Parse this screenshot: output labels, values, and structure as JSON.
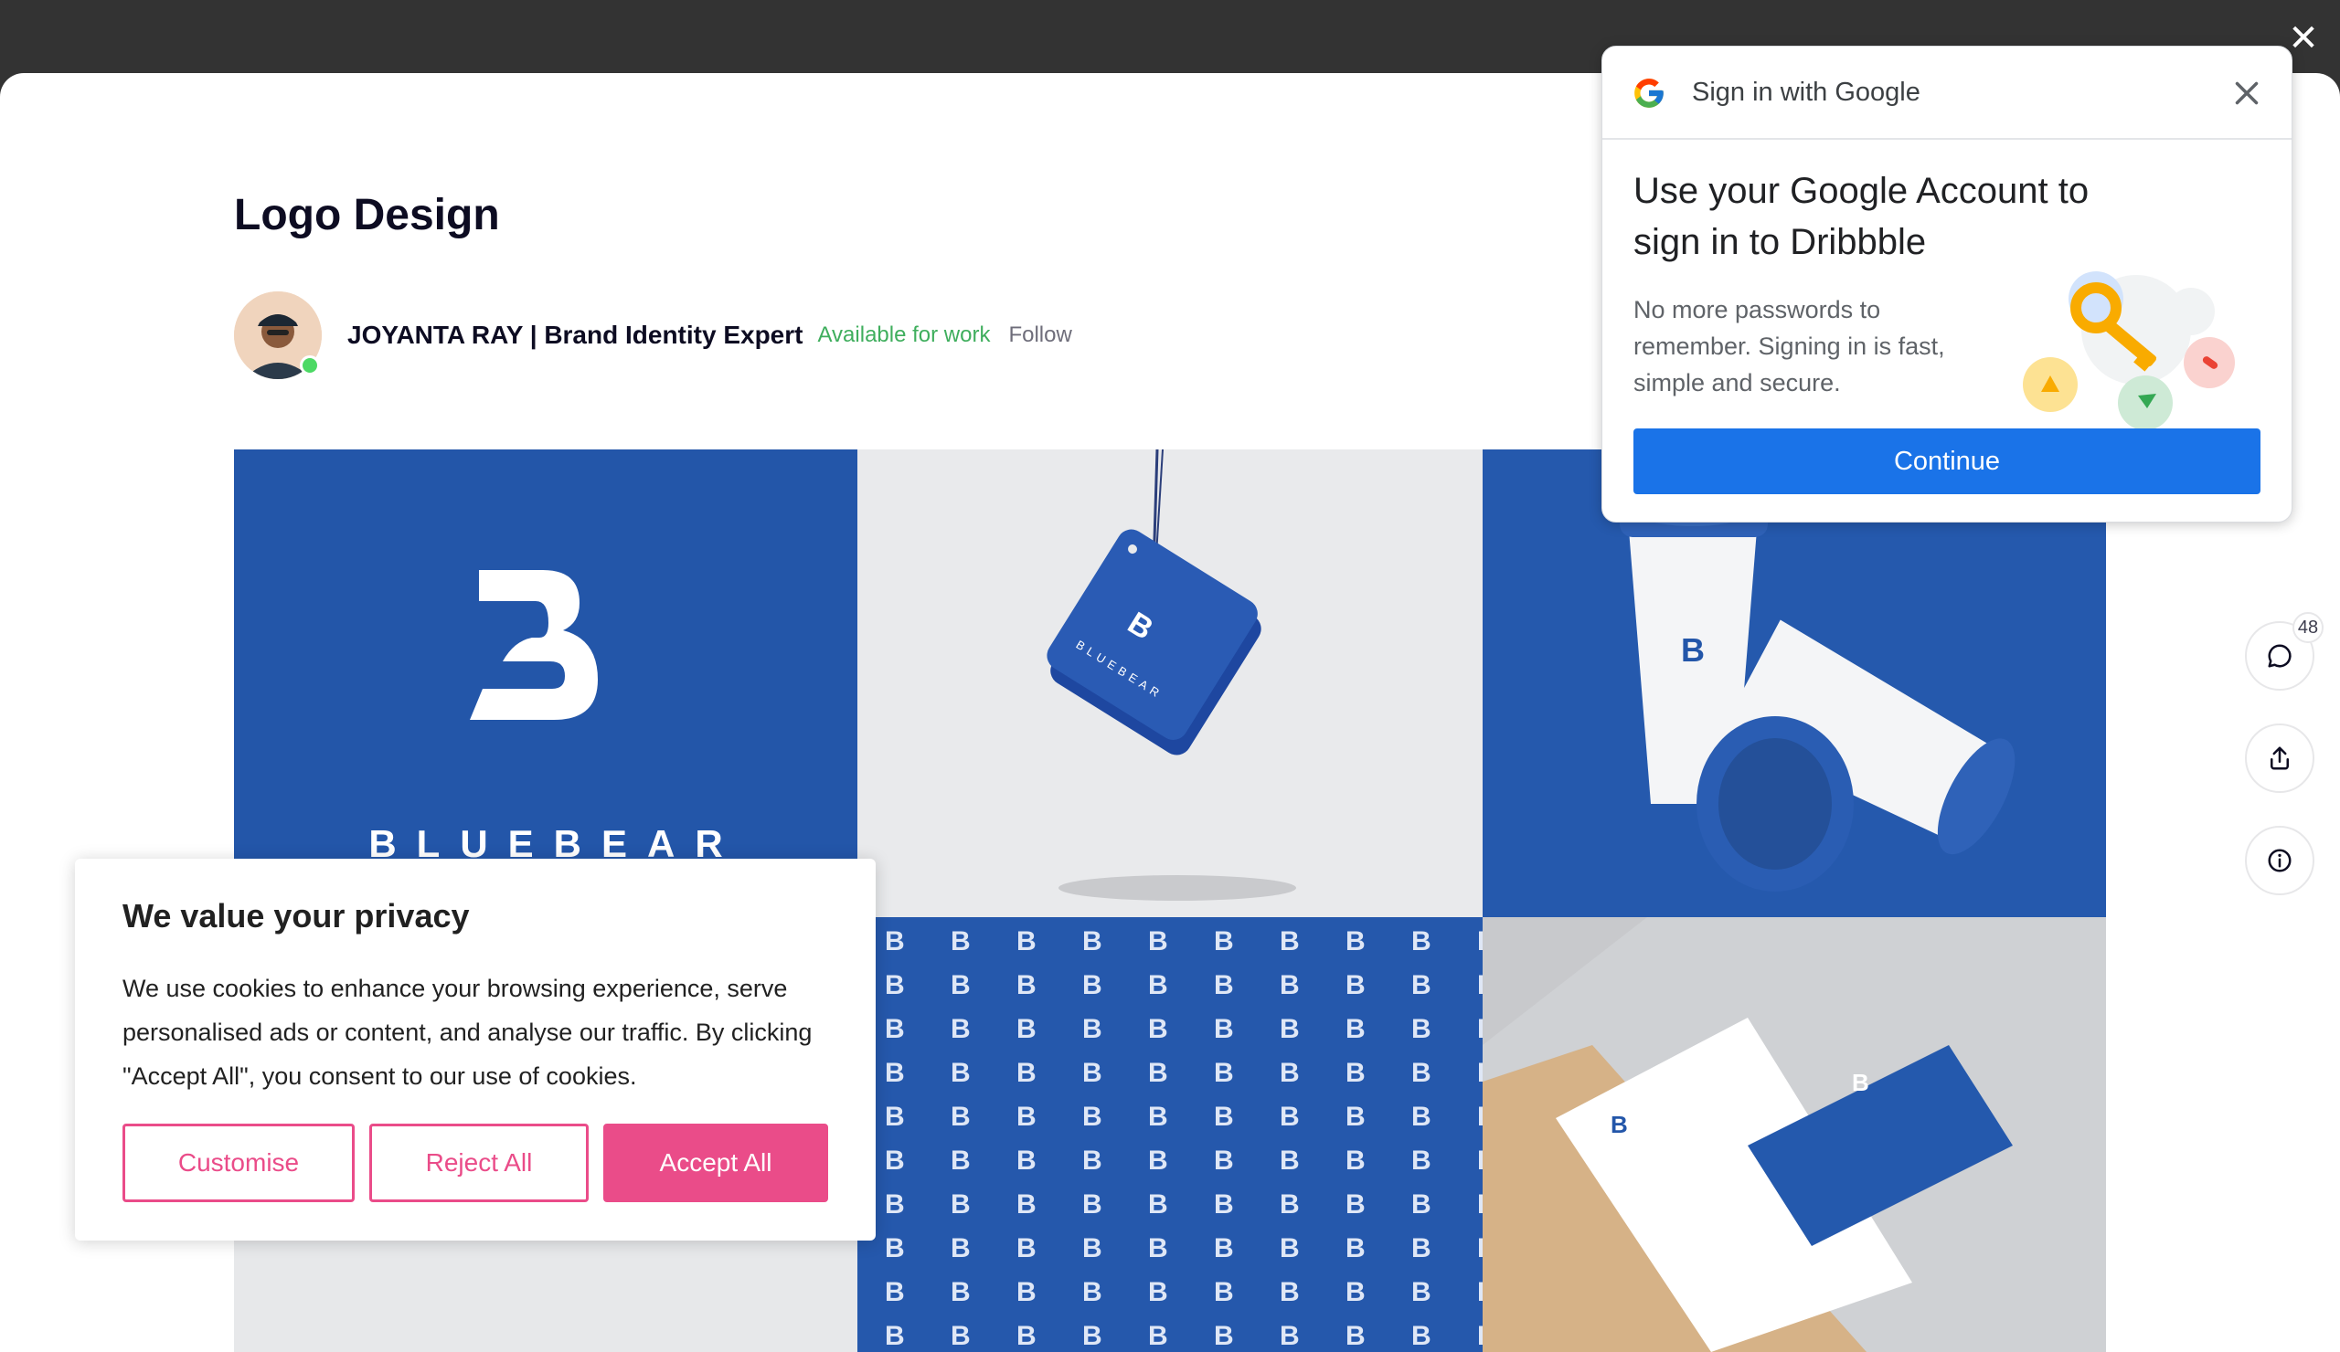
{
  "shot": {
    "title": "Logo Design",
    "author": {
      "name": "JOYANTA RAY | Brand Identity Expert",
      "availability": "Available for work",
      "follow_label": "Follow"
    },
    "brand_wordmark": "BLUEBEAR",
    "comment_count": "48"
  },
  "cookie_banner": {
    "title": "We value your privacy",
    "text": "We use cookies to enhance your browsing experience, serve personalised ads or content, and analyse our traffic. By clicking \"Accept All\", you consent to our use of cookies.",
    "customise_label": "Customise",
    "reject_label": "Reject All",
    "accept_label": "Accept All"
  },
  "google_signin": {
    "header": "Sign in with Google",
    "heading": "Use your Google Account to sign in to Dribbble",
    "body": "No more passwords to remember. Signing in is fast, simple and secure.",
    "continue_label": "Continue"
  },
  "icons": {
    "close": "close-icon",
    "comment": "comment-icon",
    "share": "share-icon",
    "info": "info-icon"
  },
  "colors": {
    "brand_blue": "#2356a9",
    "dribbble_pink": "#ea4c89",
    "google_blue": "#1a73e8",
    "available_green": "#3fae5d"
  }
}
